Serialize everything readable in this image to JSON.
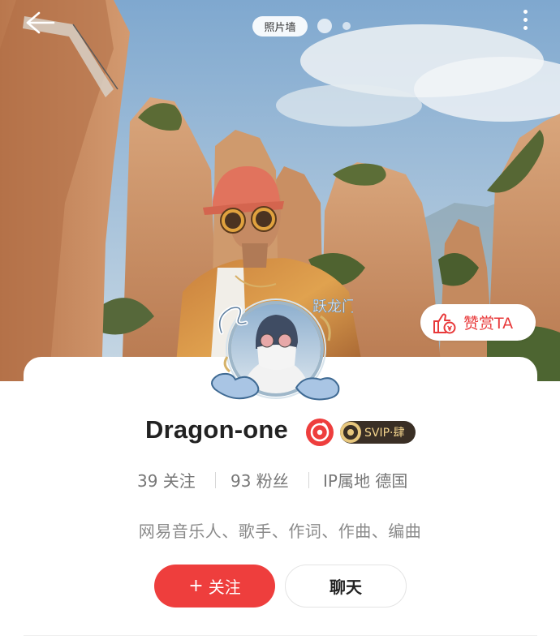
{
  "header": {
    "photo_wall_label": "照片墙"
  },
  "profile": {
    "name": "Dragon-one",
    "svip_label": "SVIP·肆",
    "avatar_frame_text": "跃龙门",
    "stats": {
      "following": "39 关注",
      "followers": "93 粉丝",
      "ip_location": "IP属地 德国"
    },
    "bio": "网易音乐人、歌手、作词、作曲、编曲"
  },
  "actions": {
    "reward_label": "赞赏TA",
    "follow_label": "关注",
    "follow_plus": "+",
    "chat_label": "聊天"
  },
  "icons": {
    "back": "back-arrow-icon",
    "more": "more-vertical-icon",
    "reward": "thumbs-up-coin-icon",
    "musician": "musician-badge-icon",
    "svip": "vinyl-coin-icon"
  },
  "colors": {
    "accent_red": "#ee3e3d",
    "svip_bg": "#3a2f25",
    "svip_text": "#f3d48d",
    "sky": "#8fb4d6",
    "rock": "#c98d62"
  }
}
